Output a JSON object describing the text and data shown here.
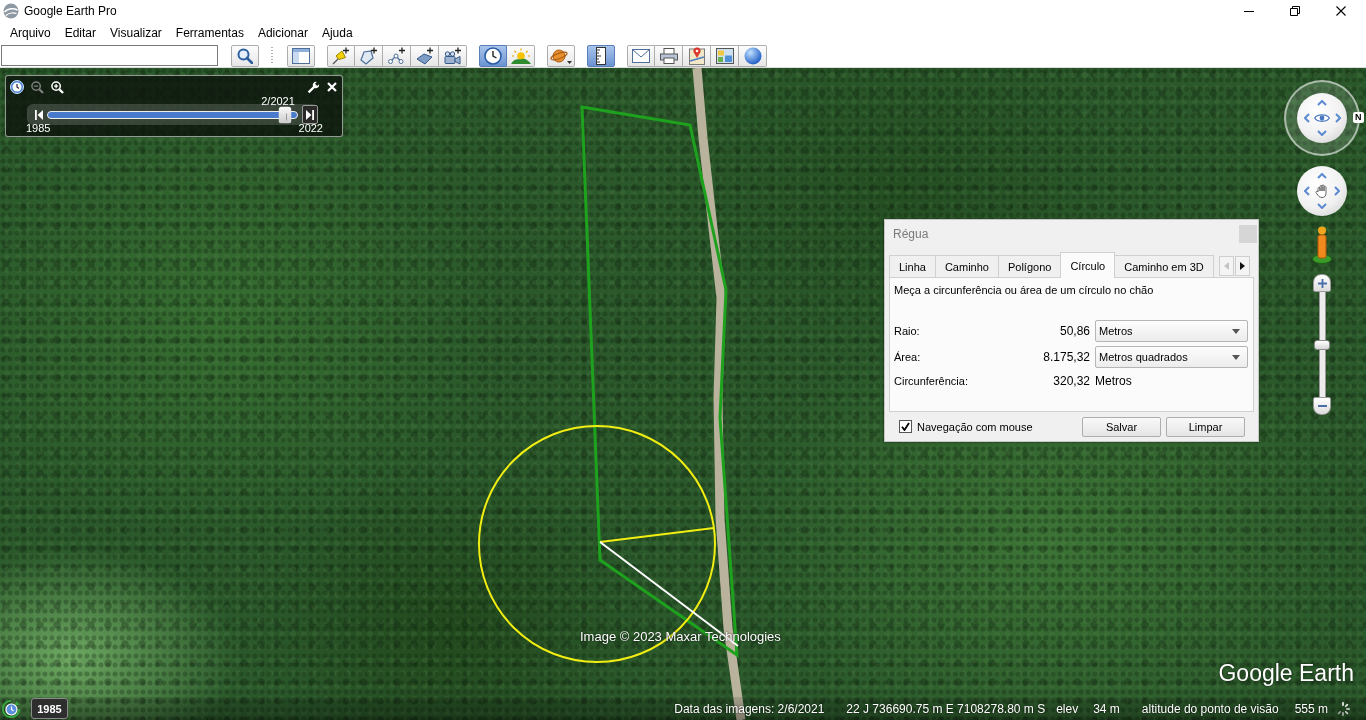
{
  "window": {
    "title": "Google Earth Pro"
  },
  "menu": [
    "Arquivo",
    "Editar",
    "Visualizar",
    "Ferramentas",
    "Adicionar",
    "Ajuda"
  ],
  "toolbar": [
    [
      {
        "kind": "search",
        "on": false
      }
    ],
    [
      {
        "kind": "sidebar",
        "on": false
      }
    ],
    [
      {
        "kind": "placemark",
        "on": false
      },
      {
        "kind": "polygon",
        "on": false
      },
      {
        "kind": "path",
        "on": false
      },
      {
        "kind": "overlay",
        "on": false
      },
      {
        "kind": "tour",
        "on": false
      }
    ],
    [
      {
        "kind": "history",
        "on": true
      },
      {
        "kind": "sunlight",
        "on": false
      }
    ],
    [
      {
        "kind": "planets",
        "on": false
      }
    ],
    [
      {
        "kind": "ruler",
        "on": true
      }
    ],
    [
      {
        "kind": "email",
        "on": false
      },
      {
        "kind": "print",
        "on": false
      },
      {
        "kind": "maps-view",
        "on": false
      },
      {
        "kind": "save-image",
        "on": false
      },
      {
        "kind": "globe",
        "on": false
      }
    ]
  ],
  "time_slider": {
    "zoom_tools": [
      {
        "kind": "zoom-out",
        "disabled": true
      },
      {
        "kind": "zoom-in",
        "disabled": false
      }
    ],
    "date": "2/2021",
    "start": "1985",
    "end": "2022",
    "level": 0.95
  },
  "navigation": {
    "north": "N",
    "zoom": {
      "level": 0.5
    }
  },
  "ruler": {
    "title": "Régua",
    "tabs": [
      {
        "label": "Linha",
        "selected": false
      },
      {
        "label": "Caminho",
        "selected": false
      },
      {
        "label": "Polígono",
        "selected": false
      },
      {
        "label": "Círculo",
        "selected": true
      },
      {
        "label": "Caminho em 3D",
        "selected": false
      }
    ],
    "tab_scroll": [
      {
        "kind": "left",
        "disabled": true
      },
      {
        "kind": "right",
        "disabled": false
      }
    ],
    "description": "Meça a circunferência ou área de um círculo no chão",
    "rows": [
      {
        "kind": "dropdown",
        "label": "Raio:",
        "value": "50,86",
        "unit": "Metros"
      },
      {
        "kind": "dropdown",
        "label": "Área:",
        "value": "8.175,32",
        "unit": "Metros quadrados"
      },
      {
        "kind": "text",
        "label": "Circunferência:",
        "value": "320,32",
        "unit": "Metros"
      }
    ],
    "mouse_navigation": {
      "label": "Navegação com mouse",
      "checked": true
    },
    "buttons": [
      "Salvar",
      "Limpar"
    ]
  },
  "map": {
    "credit": "Image © 2023 Maxar Technologies",
    "logo": "Google Earth"
  },
  "status_bar": {
    "year": "1985",
    "imagery_date": "Data das imagens: 2/6/2021",
    "coordinates": "22 J 736690.75 m E 7108278.80 m S",
    "elevation_label": "elev",
    "elevation": "34 m",
    "eye_altitude_label": "altitude do ponto de visão",
    "eye_altitude": "555 m"
  }
}
